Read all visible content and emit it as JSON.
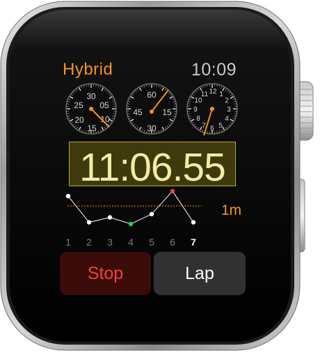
{
  "app": {
    "title": "Hybrid",
    "time": "10:09"
  },
  "colors": {
    "accent": "#f7911d",
    "stop": "#f3423b",
    "readout": "#f2eba6",
    "best_lap": "#1ed760",
    "worst_lap": "#f3423b"
  },
  "dials": [
    {
      "name": "seconds-dial",
      "labels": [
        "30",
        "05",
        "25",
        "10",
        "20",
        "15"
      ],
      "hand_value": 10
    },
    {
      "name": "minutes-dial",
      "labels": [
        "60",
        "45",
        "15",
        "30"
      ],
      "hand_value": 10
    },
    {
      "name": "hours-dial",
      "labels": [
        "9",
        "10",
        "11",
        "12",
        "1",
        "2",
        "3",
        "4",
        "5",
        "6",
        "7",
        "8"
      ],
      "hand_value": 6
    }
  ],
  "stopwatch": {
    "elapsed": "11:06.55"
  },
  "graph": {
    "span_label": "1m",
    "laps": [
      "1",
      "2",
      "3",
      "4",
      "5",
      "6",
      "7"
    ],
    "current_lap": "7",
    "lap_levels": [
      0.85,
      0.05,
      0.2,
      0.0,
      0.3,
      1.0,
      0.05
    ],
    "best_lap_index": 3,
    "worst_lap_index": 5,
    "average_level": 0.55
  },
  "buttons": {
    "stop": "Stop",
    "lap": "Lap"
  }
}
